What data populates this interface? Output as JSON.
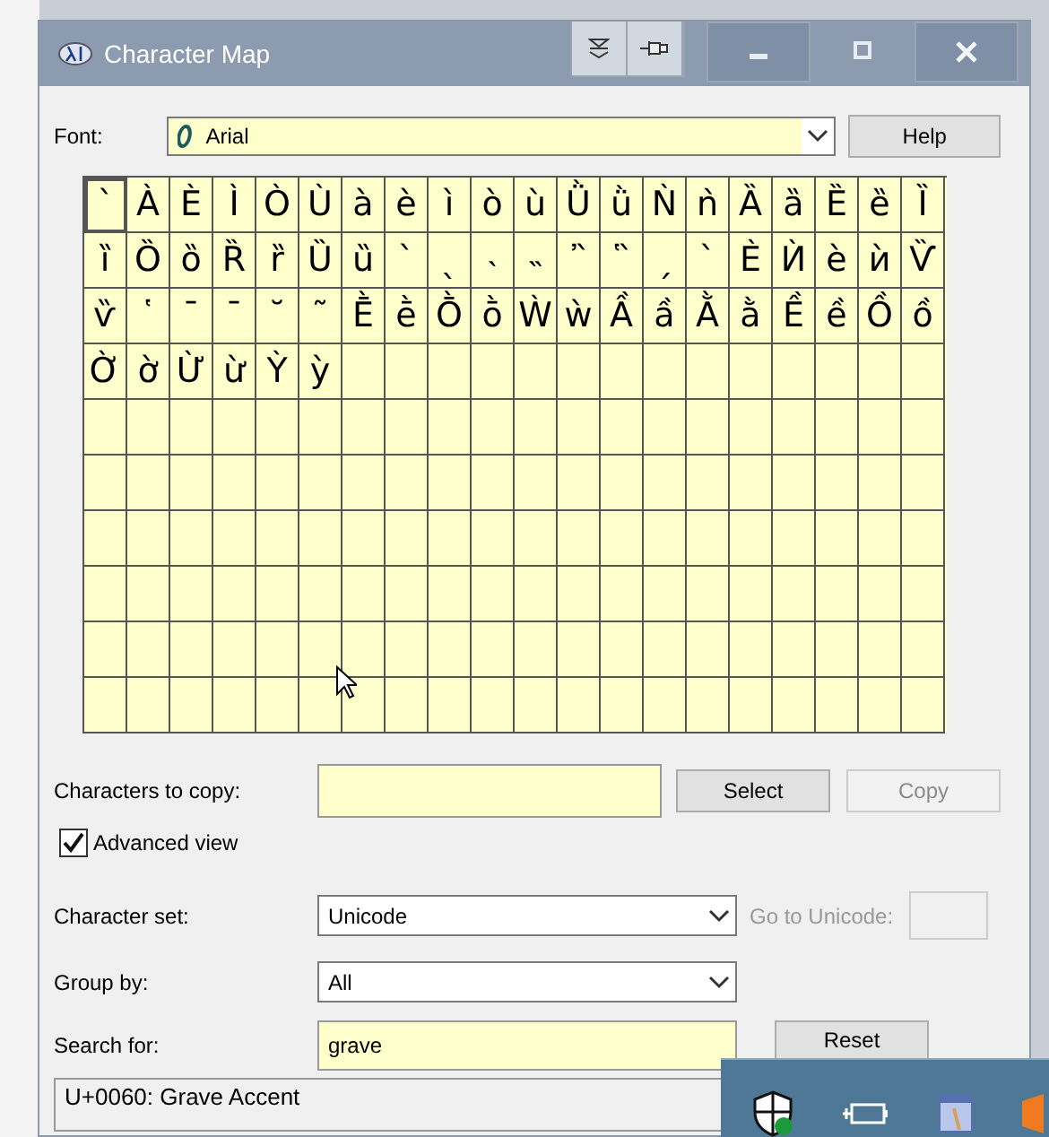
{
  "window": {
    "title": "Character Map"
  },
  "font": {
    "label": "Font:",
    "value": "Arial"
  },
  "help_button": "Help",
  "grid": {
    "rows": [
      [
        {
          "char": "`",
          "selected": true
        },
        {
          "char": "À",
          "selected": false
        },
        {
          "char": "È",
          "selected": false
        },
        {
          "char": "Ì",
          "selected": false
        },
        {
          "char": "Ò",
          "selected": false
        },
        {
          "char": "Ù",
          "selected": false
        },
        {
          "char": "à",
          "selected": false
        },
        {
          "char": "è",
          "selected": false
        },
        {
          "char": "ì",
          "selected": false
        },
        {
          "char": "ò",
          "selected": false
        },
        {
          "char": "ù",
          "selected": false
        },
        {
          "char": "Ǜ",
          "selected": false
        },
        {
          "char": "ǜ",
          "selected": false
        },
        {
          "char": "Ǹ",
          "selected": false
        },
        {
          "char": "ǹ",
          "selected": false
        },
        {
          "char": "Ȁ",
          "selected": false
        },
        {
          "char": "ȁ",
          "selected": false
        },
        {
          "char": "Ȅ",
          "selected": false
        },
        {
          "char": "ȅ",
          "selected": false
        },
        {
          "char": "Ȉ",
          "selected": false
        }
      ],
      [
        {
          "char": "ȉ",
          "selected": false
        },
        {
          "char": "Ȍ",
          "selected": false
        },
        {
          "char": "ȍ",
          "selected": false
        },
        {
          "char": "Ȑ",
          "selected": false
        },
        {
          "char": "ȑ",
          "selected": false
        },
        {
          "char": "Ȕ",
          "selected": false
        },
        {
          "char": "ȕ",
          "selected": false
        },
        {
          "char": "ˋ",
          "selected": false
        },
        {
          "char": "ˎ",
          "selected": false
        },
        {
          "char": "˴",
          "selected": false
        },
        {
          "char": "˵",
          "selected": false
        },
        {
          "char": "῍",
          "selected": false
        },
        {
          "char": "῝",
          "selected": false
        },
        {
          "char": "ˏ",
          "selected": false
        },
        {
          "char": "`",
          "selected": false
        },
        {
          "char": "Ѐ",
          "selected": false
        },
        {
          "char": "Ѝ",
          "selected": false
        },
        {
          "char": "ѐ",
          "selected": false
        },
        {
          "char": "ѝ",
          "selected": false
        },
        {
          "char": "Ѷ",
          "selected": false
        }
      ],
      [
        {
          "char": "ѷ",
          "selected": false
        },
        {
          "char": "῾",
          "selected": false
        },
        {
          "char": "ˉ",
          "selected": false
        },
        {
          "char": "¯",
          "selected": false
        },
        {
          "char": "˘",
          "selected": false
        },
        {
          "char": "˜",
          "selected": false
        },
        {
          "char": "Ḕ",
          "selected": false
        },
        {
          "char": "ḕ",
          "selected": false
        },
        {
          "char": "Ṑ",
          "selected": false
        },
        {
          "char": "ṑ",
          "selected": false
        },
        {
          "char": "Ẁ",
          "selected": false
        },
        {
          "char": "ẁ",
          "selected": false
        },
        {
          "char": "Ầ",
          "selected": false
        },
        {
          "char": "ầ",
          "selected": false
        },
        {
          "char": "Ằ",
          "selected": false
        },
        {
          "char": "ằ",
          "selected": false
        },
        {
          "char": "Ề",
          "selected": false
        },
        {
          "char": "ề",
          "selected": false
        },
        {
          "char": "Ồ",
          "selected": false
        },
        {
          "char": "ồ",
          "selected": false
        }
      ],
      [
        {
          "char": "Ờ",
          "selected": false
        },
        {
          "char": "ờ",
          "selected": false
        },
        {
          "char": "Ừ",
          "selected": false
        },
        {
          "char": "ừ",
          "selected": false
        },
        {
          "char": "Ỳ",
          "selected": false
        },
        {
          "char": "ỳ",
          "selected": false
        }
      ]
    ]
  },
  "copy_row": {
    "label": "Characters to copy:",
    "select": "Select",
    "copy": "Copy",
    "copy_disabled": true
  },
  "advanced_view": {
    "label": "Advanced view",
    "checked": true
  },
  "character_set": {
    "label": "Character set:",
    "value": "Unicode"
  },
  "go_to_unicode": {
    "label": "Go to Unicode:",
    "disabled": true
  },
  "group_by": {
    "label": "Group by:",
    "value": "All"
  },
  "search_for": {
    "label": "Search for:",
    "value": "grave",
    "reset": "Reset"
  },
  "status_bar": "U+0060: Grave Accent"
}
